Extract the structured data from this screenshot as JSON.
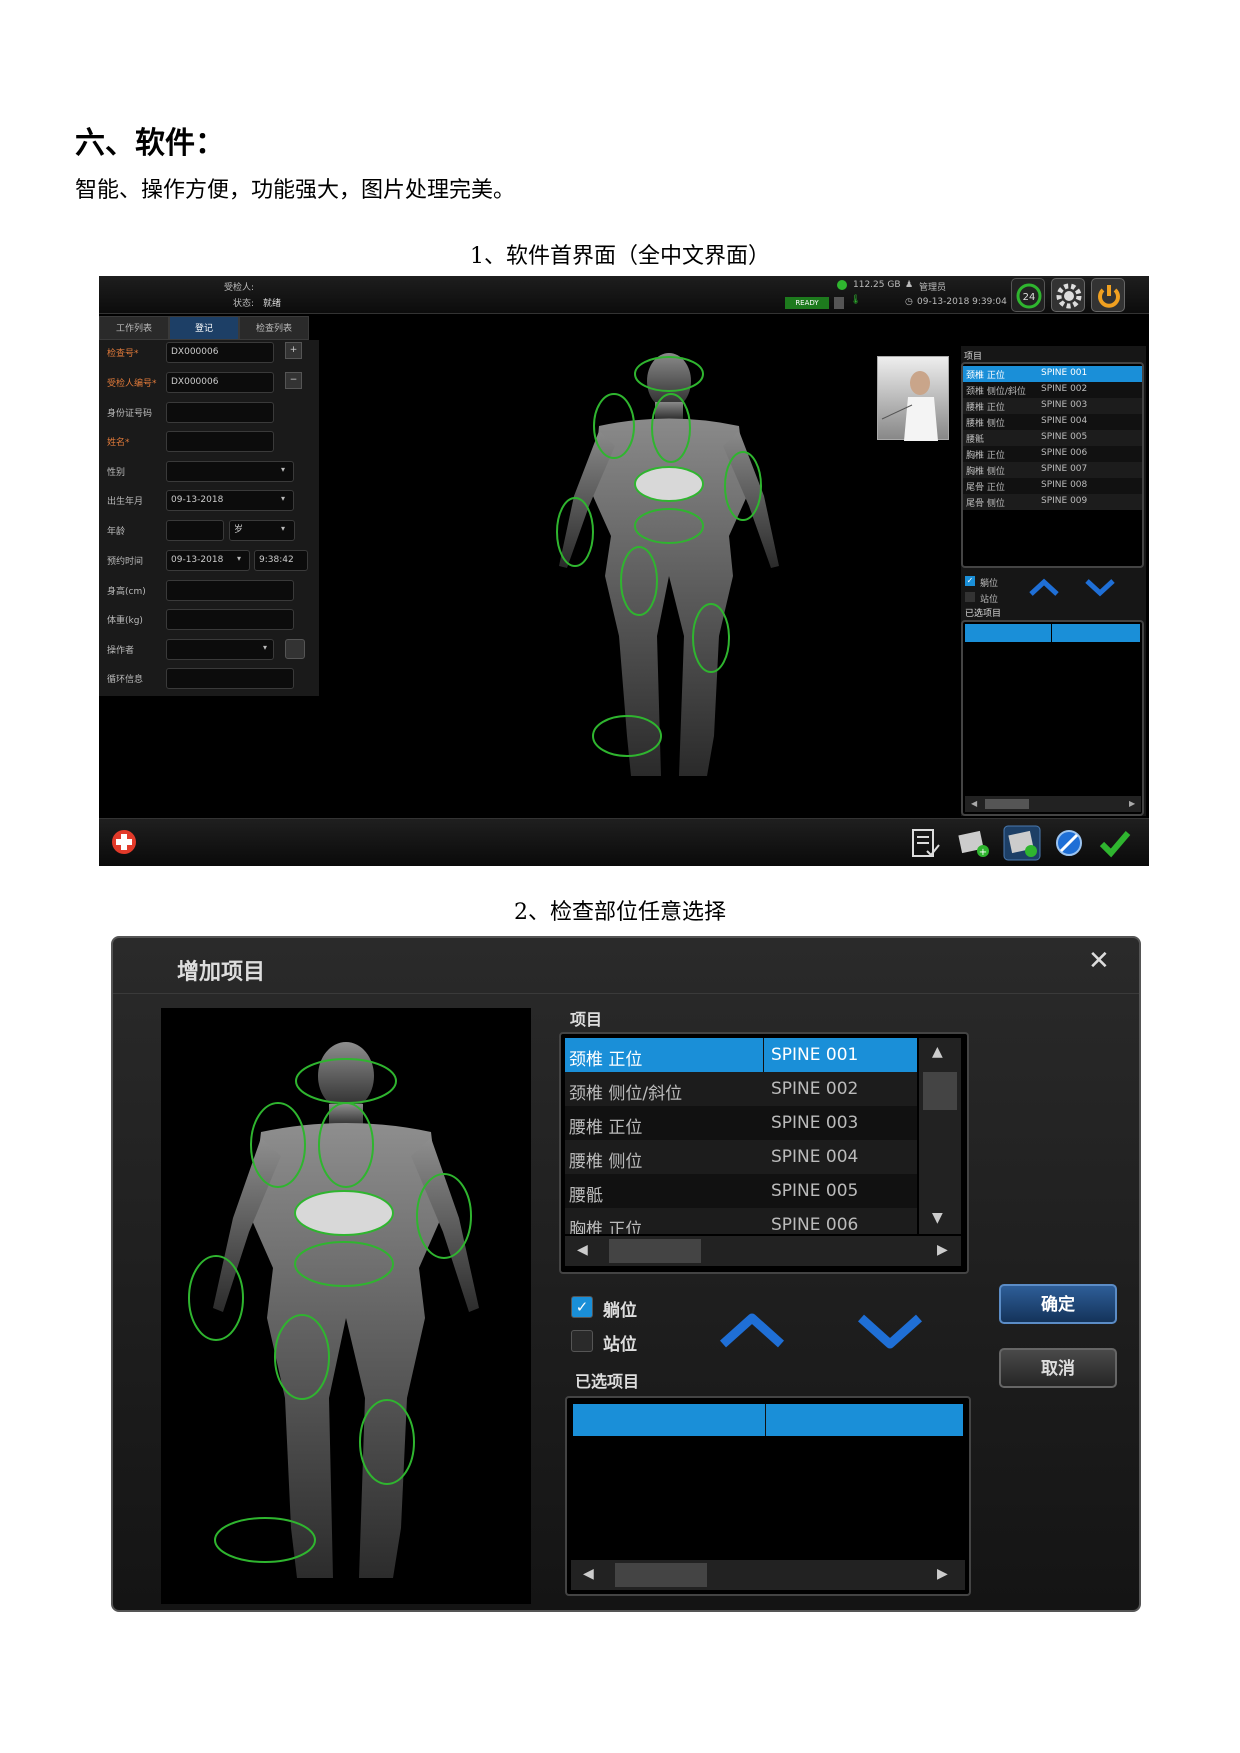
{
  "doc": {
    "heading": "六、软件：",
    "intro": "智能、操作方便，功能强大，图片处理完美。",
    "caption1": "1、软件首界面（全中文界面）",
    "caption2": "2、检查部位任意选择"
  },
  "screen1": {
    "header": {
      "patient_label": "受检人:",
      "status_label": "状态:",
      "status_value": "就绪",
      "disk": "112.25 GB",
      "user": "管理员",
      "ready": "READY",
      "datetime": "09-13-2018 9:39:04",
      "badge": "24"
    },
    "tabs": [
      "工作列表",
      "登记",
      "检查列表"
    ],
    "form": [
      {
        "label": "检查号*",
        "value": "DX000006",
        "required": true
      },
      {
        "label": "受检人编号*",
        "value": "DX000006",
        "required": true
      },
      {
        "label": "身份证号码",
        "value": "",
        "required": false
      },
      {
        "label": "姓名*",
        "value": "",
        "required": true
      },
      {
        "label": "性别",
        "value": "",
        "required": false
      },
      {
        "label": "出生年月",
        "value": "09-13-2018",
        "required": false
      },
      {
        "label": "年龄",
        "value": "",
        "required": false
      },
      {
        "label": "预约时间",
        "value": "09-13-2018",
        "required": false
      },
      {
        "label": "身高(cm)",
        "value": "",
        "required": false
      },
      {
        "label": "体重(kg)",
        "value": "",
        "required": false
      },
      {
        "label": "操作者",
        "value": "",
        "required": false
      },
      {
        "label": "循环信息",
        "value": "",
        "required": false
      }
    ],
    "age_unit": "岁",
    "appt_time": "9:38:42",
    "items_title": "项目",
    "items": [
      {
        "name": "颈椎 正位",
        "code": "SPINE 001"
      },
      {
        "name": "颈椎 侧位/斜位",
        "code": "SPINE 002"
      },
      {
        "name": "腰椎 正位",
        "code": "SPINE 003"
      },
      {
        "name": "腰椎 侧位",
        "code": "SPINE 004"
      },
      {
        "name": "腰骶",
        "code": "SPINE 005"
      },
      {
        "name": "胸椎 正位",
        "code": "SPINE 006"
      },
      {
        "name": "胸椎 侧位",
        "code": "SPINE 007"
      },
      {
        "name": "尾骨 正位",
        "code": "SPINE 008"
      },
      {
        "name": "尾骨 侧位",
        "code": "SPINE 009"
      }
    ],
    "lying": "躺位",
    "standing": "站位",
    "selected_title": "已选项目"
  },
  "dialog": {
    "title": "增加项目",
    "items_title": "项目",
    "items": [
      {
        "name": "颈椎 正位",
        "code": "SPINE 001"
      },
      {
        "name": "颈椎 侧位/斜位",
        "code": "SPINE 002"
      },
      {
        "name": "腰椎 正位",
        "code": "SPINE 003"
      },
      {
        "name": "腰椎 侧位",
        "code": "SPINE 004"
      },
      {
        "name": "腰骶",
        "code": "SPINE 005"
      },
      {
        "name": "胸椎 正位",
        "code": "SPINE 006"
      }
    ],
    "lying": "躺位",
    "standing": "站位",
    "selected_title": "已选项目",
    "ok": "确定",
    "cancel": "取消"
  },
  "colors": {
    "select_blue": "#1a8fd8",
    "accent_green": "#2fb52f",
    "arrow_blue": "#1f6fd6"
  }
}
